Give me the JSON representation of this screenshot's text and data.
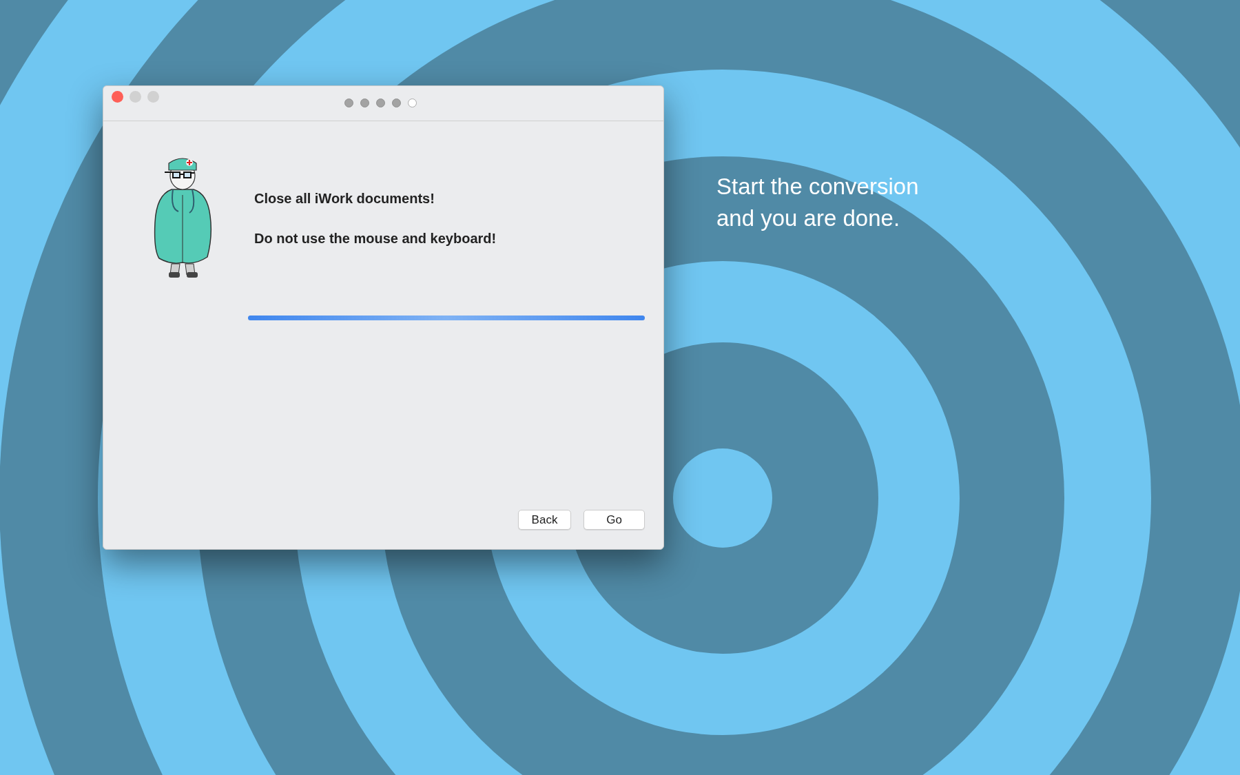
{
  "window": {
    "step_dots": [
      {
        "selected": false
      },
      {
        "selected": false
      },
      {
        "selected": false
      },
      {
        "selected": false
      },
      {
        "selected": true
      }
    ]
  },
  "messages": [
    "Close all iWork documents!",
    "Do not use the mouse and keyboard!"
  ],
  "progress": {
    "level": 1
  },
  "buttons": [
    "Back",
    "Go"
  ],
  "caption": [
    "Start the conversion",
    "and you are done."
  ]
}
